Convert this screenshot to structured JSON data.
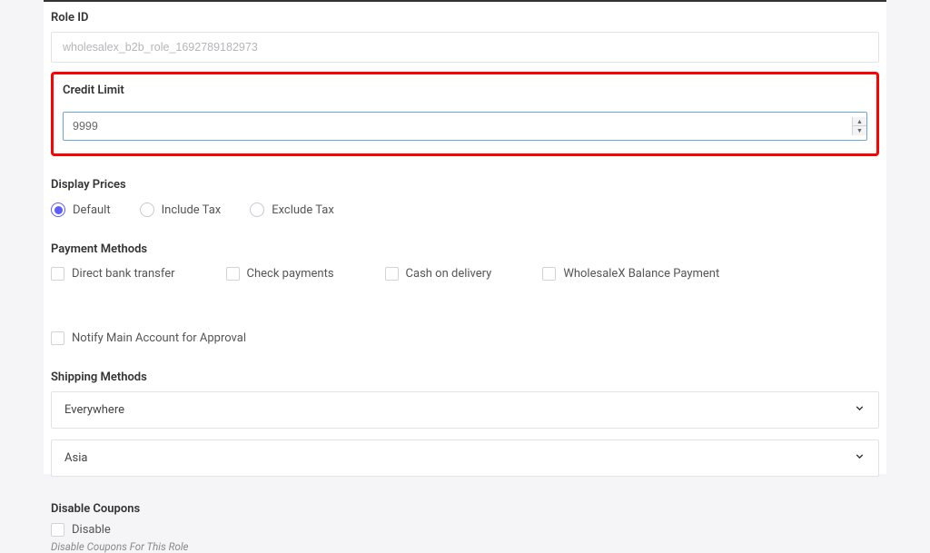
{
  "roleId": {
    "label": "Role ID",
    "value": "wholesalex_b2b_role_1692789182973"
  },
  "creditLimit": {
    "label": "Credit Limit",
    "value": "9999"
  },
  "displayPrices": {
    "label": "Display Prices",
    "options": {
      "default": "Default",
      "includeTax": "Include Tax",
      "excludeTax": "Exclude Tax"
    },
    "selected": "default"
  },
  "paymentMethods": {
    "label": "Payment Methods",
    "options": {
      "bankTransfer": "Direct bank transfer",
      "checkPayments": "Check payments",
      "cod": "Cash on delivery",
      "balance": "WholesaleX Balance Payment",
      "notify": "Notify Main Account for Approval"
    }
  },
  "shippingMethods": {
    "label": "Shipping Methods",
    "items": [
      {
        "label": "Everywhere"
      },
      {
        "label": "Asia"
      }
    ]
  },
  "disableCoupons": {
    "label": "Disable Coupons",
    "checkboxLabel": "Disable",
    "helper": "Disable Coupons For This Role"
  }
}
